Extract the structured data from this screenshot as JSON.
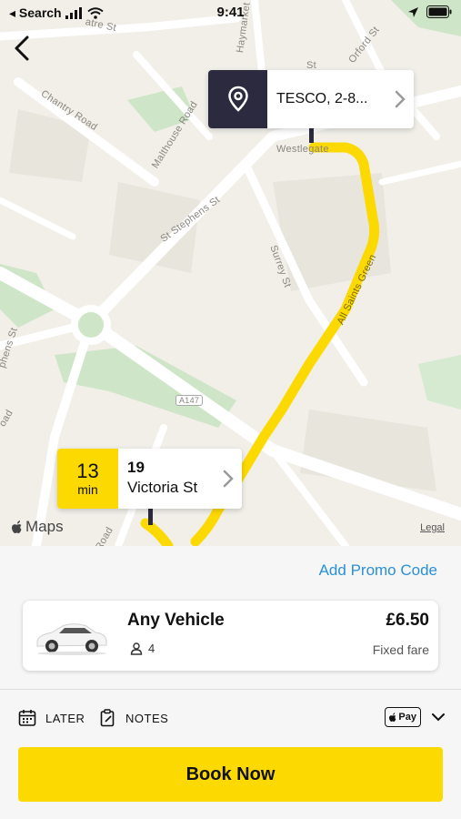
{
  "status_bar": {
    "back_app_label": "◂ Search",
    "time": "9:41"
  },
  "map": {
    "destination": {
      "label": "TESCO, 2-8..."
    },
    "origin": {
      "eta_value": "13",
      "eta_unit": "min",
      "line1": "19",
      "line2": "Victoria St"
    },
    "streets": [
      "Chantry Road",
      "Malthouse Road",
      "St Stephens St",
      "Surrey St",
      "All Saints Green",
      "Westlegate",
      "Haymarket",
      "Orford St",
      "St",
      "A147",
      "Road",
      "phens St",
      "oad",
      "atre St"
    ],
    "attribution": "Maps",
    "legal": "Legal"
  },
  "sheet": {
    "promo_label": "Add Promo Code",
    "vehicle": {
      "name": "Any Vehicle",
      "seats": "4",
      "price": "£6.50",
      "fare_type": "Fixed fare"
    },
    "options": {
      "later_label": "LATER",
      "notes_label": "NOTES",
      "payment_badge": "Pay"
    },
    "book_label": "Book Now"
  },
  "colors": {
    "accent_yellow": "#fcd900",
    "pin_navy": "#2b2a3f",
    "link_blue": "#2a8fd9",
    "map_bg": "#f1efe8",
    "park_green": "#cfe5c8"
  }
}
